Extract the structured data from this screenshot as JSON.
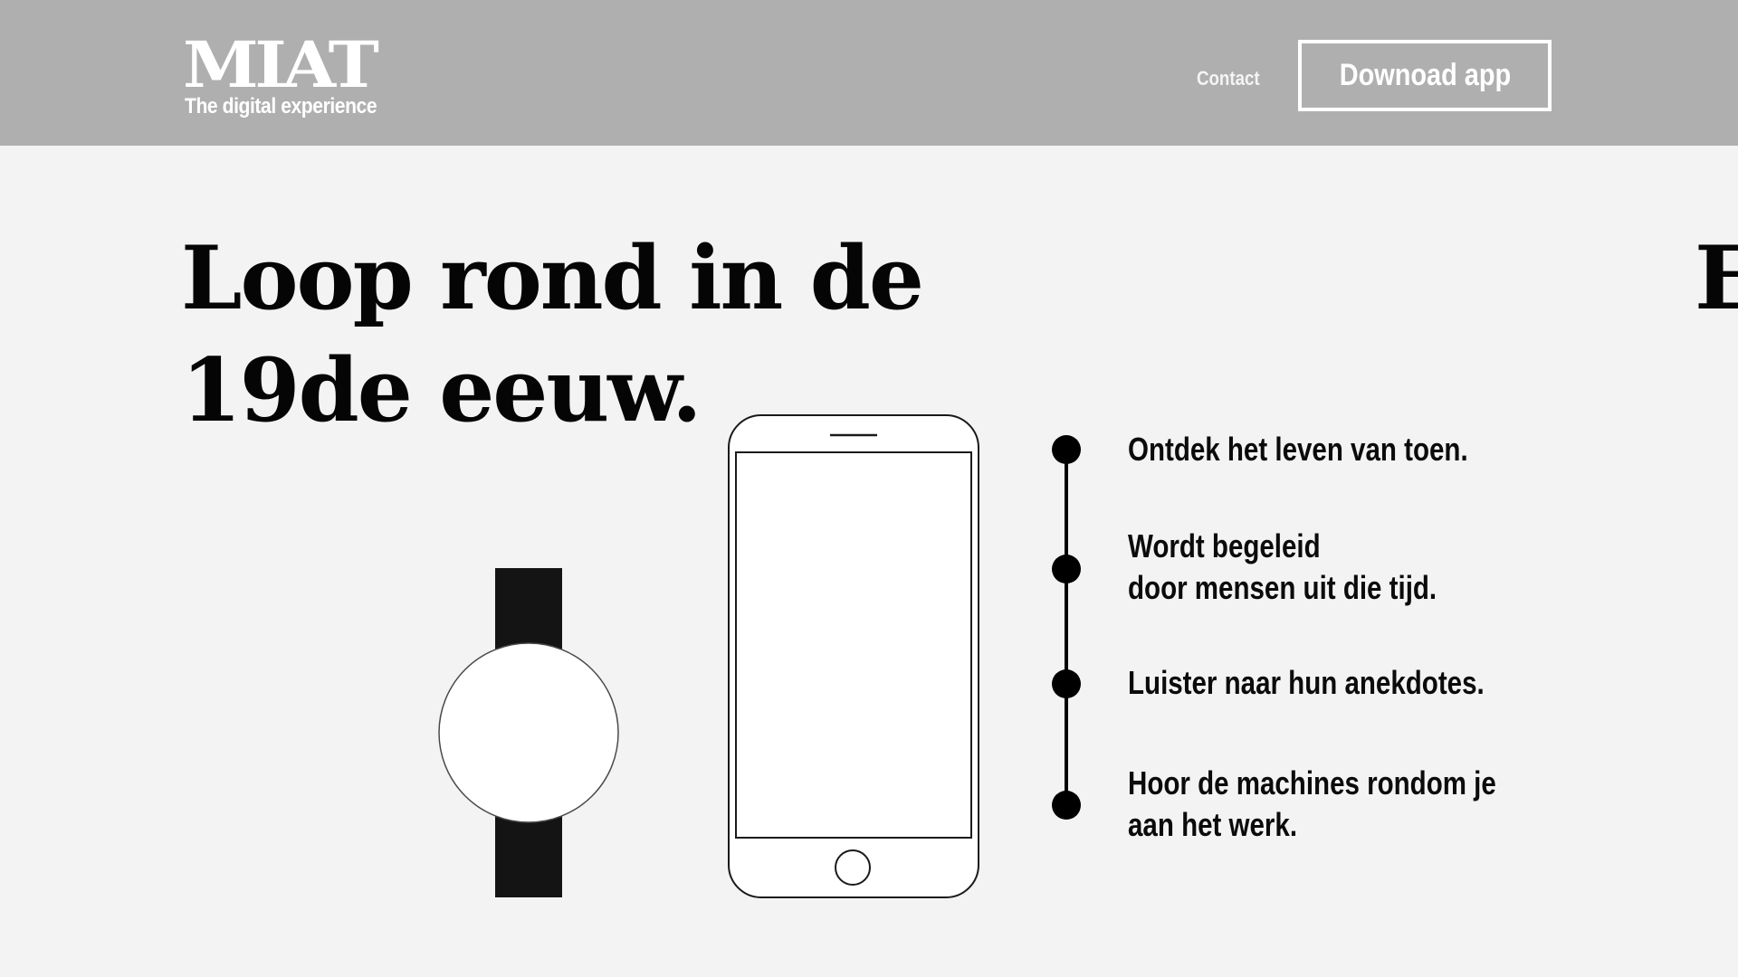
{
  "header": {
    "logo_title": "MIAT",
    "logo_subtitle": "The digital experience",
    "nav_contact": "Contact",
    "download_label": "Downoad app",
    "bg_color": "#afafaf"
  },
  "hero": {
    "title_line1": "Loop rond in de",
    "title_line2": "19de eeuw.",
    "next_slide_peek": "E"
  },
  "features": [
    {
      "line1": "Ontdek het leven van toen.",
      "line2": ""
    },
    {
      "line1": "Wordt begeleid",
      "line2": "door mensen uit die tijd."
    },
    {
      "line1": "Luister naar hun anekdotes.",
      "line2": ""
    },
    {
      "line1": "Hoor de machines rondom je",
      "line2": "aan het werk."
    }
  ],
  "illustrations": {
    "watch_icon": "smartwatch-icon",
    "phone_icon": "smartphone-icon"
  }
}
